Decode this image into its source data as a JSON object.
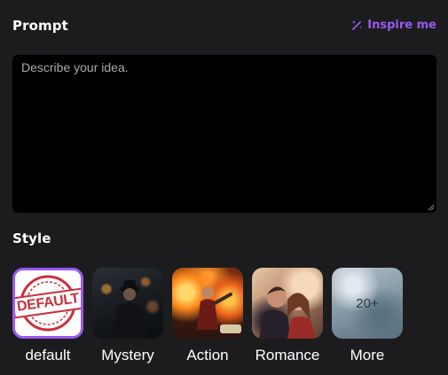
{
  "prompt": {
    "title": "Prompt",
    "placeholder": "Describe your idea.",
    "value": ""
  },
  "inspire": {
    "label": "Inspire me",
    "icon": "magic-wand-icon",
    "color": "#9b59f0"
  },
  "style": {
    "title": "Style",
    "selected": "default",
    "items": [
      {
        "label": "default",
        "thumbnail_text": "DEFAULT"
      },
      {
        "label": "Mystery"
      },
      {
        "label": "Action"
      },
      {
        "label": "Romance"
      },
      {
        "label": "More",
        "thumbnail_text": "20+"
      }
    ]
  },
  "colors": {
    "background": "#1c1c1e",
    "prompt_box": "#000000",
    "accent": "#9b59f0",
    "stamp": "#c9303c"
  }
}
